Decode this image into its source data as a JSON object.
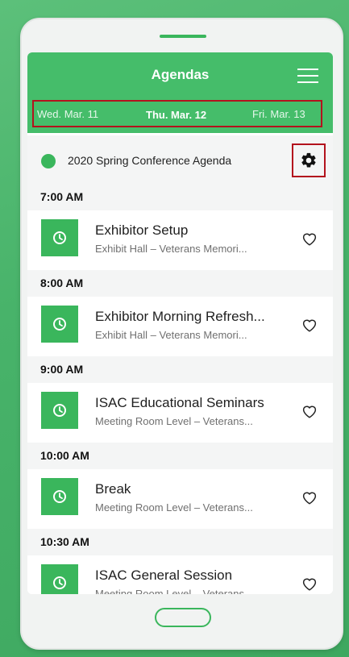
{
  "header": {
    "title": "Agendas"
  },
  "date_tabs": [
    {
      "label": "Wed. Mar. 11",
      "active": false
    },
    {
      "label": "Thu. Mar. 12",
      "active": true
    },
    {
      "label": "Fri. Mar. 13",
      "active": false
    }
  ],
  "agenda": {
    "name": "2020 Spring Conference Agenda",
    "dot_color": "#3ab65c"
  },
  "colors": {
    "brand": "#45bd6a",
    "highlight_border": "#b3121d"
  },
  "schedule": [
    {
      "time": "7:00 AM",
      "title": "Exhibitor Setup",
      "location": "Exhibit Hall – Veterans Memori..."
    },
    {
      "time": "8:00 AM",
      "title": "Exhibitor Morning Refresh...",
      "location": "Exhibit Hall – Veterans Memori..."
    },
    {
      "time": "9:00 AM",
      "title": "ISAC Educational Seminars",
      "location": "Meeting Room Level – Veterans..."
    },
    {
      "time": "10:00 AM",
      "title": "Break",
      "location": "Meeting Room Level – Veterans..."
    },
    {
      "time": "10:30 AM",
      "title": "ISAC General Session",
      "location": "Meeting Room Level – Veterans..."
    }
  ],
  "icons": {
    "menu": "hamburger-icon",
    "settings": "gear-icon",
    "session": "clock-icon",
    "favorite": "heart-icon"
  }
}
